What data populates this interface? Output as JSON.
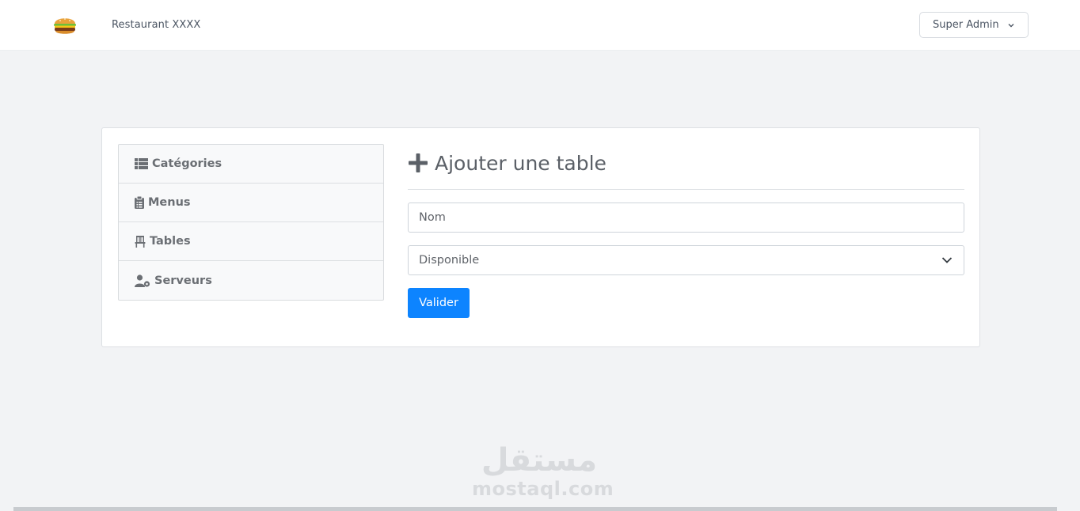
{
  "header": {
    "logo_icon": "burger-icon",
    "brand": "Restaurant XXXX",
    "user_menu": {
      "label": "Super Admin",
      "icon": "chevron-down-icon"
    }
  },
  "sidebar": {
    "items": [
      {
        "label": "Catégories",
        "icon": "list-icon"
      },
      {
        "label": "Menus",
        "icon": "clipboard-icon"
      },
      {
        "label": "Tables",
        "icon": "chair-icon"
      },
      {
        "label": "Serveurs",
        "icon": "user-cog-icon"
      }
    ]
  },
  "form": {
    "title": "Ajouter une table",
    "title_icon": "plus-icon",
    "name_placeholder": "Nom",
    "status_selected": "Disponible",
    "submit_label": "Valider"
  },
  "watermark": {
    "arabic": "مستقل",
    "latin": "mostaql.com"
  },
  "colors": {
    "primary": "#0d84ff",
    "background": "#f2f3f5",
    "card": "#ffffff",
    "text": "#4b5563"
  }
}
